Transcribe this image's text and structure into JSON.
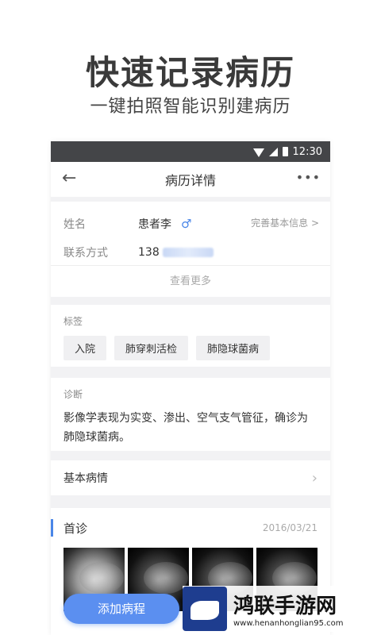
{
  "hero": {
    "title": "快速记录病历",
    "subtitle": "一键拍照智能识别建病历"
  },
  "statusbar": {
    "time": "12:30"
  },
  "nav": {
    "back_icon": "back-arrow-icon",
    "title": "病历详情",
    "more": "•••"
  },
  "patient": {
    "name_label": "姓名",
    "name_value": "患者李",
    "gender_symbol": "♂",
    "complete_link": "完善基本信息 >",
    "contact_label": "联系方式",
    "contact_value": "138",
    "show_more": "查看更多"
  },
  "tags": {
    "label": "标签",
    "items": [
      "入院",
      "肺穿刺活检",
      "肺隐球菌病"
    ]
  },
  "diagnosis": {
    "label": "诊断",
    "text": "影像学表现为实变、渗出、空气支气管征，确诊为肺隐球菌病。"
  },
  "basic": {
    "label": "基本病情",
    "chevron": "›"
  },
  "visit": {
    "title": "首诊",
    "date": "2016/03/21"
  },
  "fab": {
    "label": "添加病程"
  },
  "watermark": {
    "name": "鸿联手游网",
    "url": "www.henanhonglian95.com"
  },
  "colors": {
    "accent": "#4a86e8",
    "statusbar": "#444548"
  }
}
